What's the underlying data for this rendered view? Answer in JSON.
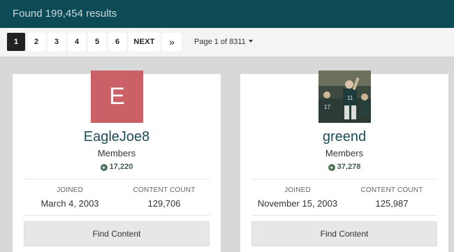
{
  "header": {
    "results_text": "Found 199,454 results"
  },
  "pagination": {
    "pages": [
      "1",
      "2",
      "3",
      "4",
      "5",
      "6"
    ],
    "next_label": "NEXT",
    "last_label": "»",
    "page_of": "Page 1 of 8311"
  },
  "members": [
    {
      "avatar_letter": "E",
      "avatar_color": "#c96166",
      "name": "EagleJoe8",
      "group": "Members",
      "reputation": "17,220",
      "joined_label": "JOINED",
      "joined": "March 4, 2003",
      "content_label": "CONTENT COUNT",
      "content_count": "129,706",
      "button_label": "Find Content"
    },
    {
      "avatar_type": "photo",
      "name": "greend",
      "group": "Members",
      "reputation": "37,278",
      "joined_label": "JOINED",
      "joined": "November 15, 2003",
      "content_label": "CONTENT COUNT",
      "content_count": "125,987",
      "button_label": "Find Content"
    }
  ],
  "colors": {
    "header_bg": "#0c4b55",
    "name_color": "#1d4d56",
    "active_page_bg": "#222222"
  }
}
